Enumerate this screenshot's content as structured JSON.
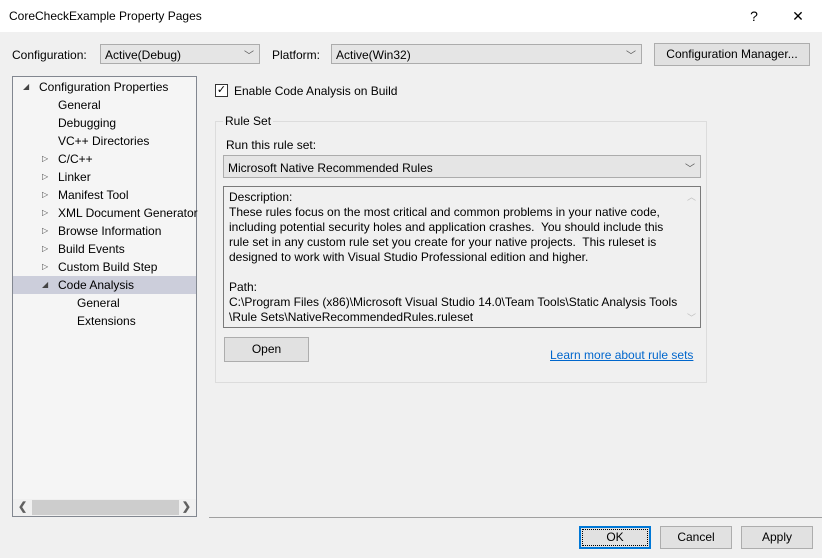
{
  "window": {
    "title": "CoreCheckExample Property Pages",
    "help_label": "?",
    "close_label": "✕"
  },
  "toolbar": {
    "configuration_label": "Configuration:",
    "configuration_value": "Active(Debug)",
    "platform_label": "Platform:",
    "platform_value": "Active(Win32)",
    "configuration_manager_label": "Configuration Manager...",
    "chevron": "﹀"
  },
  "tree": {
    "expanded_glyph": "◢",
    "collapsed_glyph": "▷",
    "items": [
      {
        "label": "Configuration Properties",
        "state": "expanded",
        "level": 0
      },
      {
        "label": "General",
        "state": "leaf",
        "level": 1
      },
      {
        "label": "Debugging",
        "state": "leaf",
        "level": 1
      },
      {
        "label": "VC++ Directories",
        "state": "leaf",
        "level": 1
      },
      {
        "label": "C/C++",
        "state": "collapsed",
        "level": 1
      },
      {
        "label": "Linker",
        "state": "collapsed",
        "level": 1
      },
      {
        "label": "Manifest Tool",
        "state": "collapsed",
        "level": 1
      },
      {
        "label": "XML Document Generator",
        "state": "collapsed",
        "level": 1
      },
      {
        "label": "Browse Information",
        "state": "collapsed",
        "level": 1
      },
      {
        "label": "Build Events",
        "state": "collapsed",
        "level": 1
      },
      {
        "label": "Custom Build Step",
        "state": "collapsed",
        "level": 1
      },
      {
        "label": "Code Analysis",
        "state": "expanded",
        "level": 1,
        "selected": true
      },
      {
        "label": "General",
        "state": "leaf",
        "level": 2
      },
      {
        "label": "Extensions",
        "state": "leaf",
        "level": 2
      }
    ],
    "scroll_left": "❮",
    "scroll_right": "❯"
  },
  "main": {
    "enable_checkbox_label": "Enable Code Analysis on Build",
    "enable_checked": true,
    "check_glyph": "✓",
    "ruleset_group_label": "Rule Set",
    "run_ruleset_label": "Run this rule set:",
    "ruleset_value": "Microsoft Native Recommended Rules",
    "description": "Description:\nThese rules focus on the most critical and common problems in your native code, including potential security holes and application crashes.  You should include this rule set in any custom rule set you create for your native projects.  This ruleset is designed to work with Visual Studio Professional edition and higher.\n\nPath:\nC:\\Program Files (x86)\\Microsoft Visual Studio 14.0\\Team Tools\\Static Analysis Tools\n\\Rule Sets\\NativeRecommendedRules.ruleset",
    "scroll_up": "︿",
    "scroll_down": "﹀",
    "open_label": "Open",
    "learn_more_label": "Learn more about rule sets"
  },
  "footer": {
    "ok_label": "OK",
    "cancel_label": "Cancel",
    "apply_label": "Apply"
  }
}
